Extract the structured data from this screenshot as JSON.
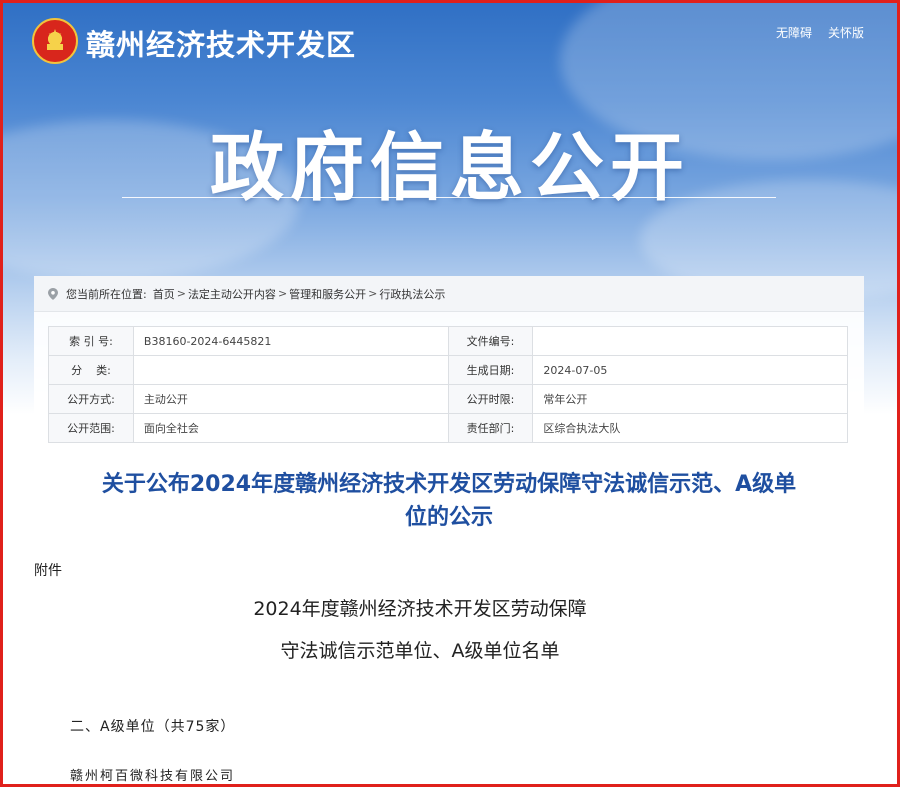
{
  "header": {
    "site_name": "赣州经济技术开发区",
    "links": [
      "无障碍",
      "关怀版"
    ],
    "hero_title": "政府信息公开"
  },
  "breadcrumb": {
    "label": "您当前所在位置:",
    "items": [
      "首页",
      "法定主动公开内容",
      "管理和服务公开",
      "行政执法公示"
    ],
    "separator": ">"
  },
  "meta": {
    "rows": [
      {
        "k1": "索 引 号:",
        "v1": "B38160-2024-6445821",
        "k2": "文件编号:",
        "v2": ""
      },
      {
        "k1": "分    类:",
        "v1": "",
        "k2": "生成日期:",
        "v2": "2024-07-05"
      },
      {
        "k1": "公开方式:",
        "v1": "主动公开",
        "k2": "公开时限:",
        "v2": "常年公开"
      },
      {
        "k1": "公开范围:",
        "v1": "面向全社会",
        "k2": "责任部门:",
        "v2": "区综合执法大队"
      }
    ]
  },
  "article": {
    "title_line1": "关于公布2024年度赣州经济技术开发区劳动保障守法诚信示范、A级单",
    "title_line2": "位的公示",
    "attachment_label": "附件",
    "list_title_line1": "2024年度赣州经济技术开发区劳动保障",
    "list_title_line2": "守法诚信示范单位、A级单位名单",
    "section_heading": "二、A级单位（共75家）",
    "first_company": "赣州柯百微科技有限公司"
  },
  "colors": {
    "frame": "#e0201b",
    "title_blue": "#1f4fa0",
    "banner_top": "#2f6fc4"
  }
}
